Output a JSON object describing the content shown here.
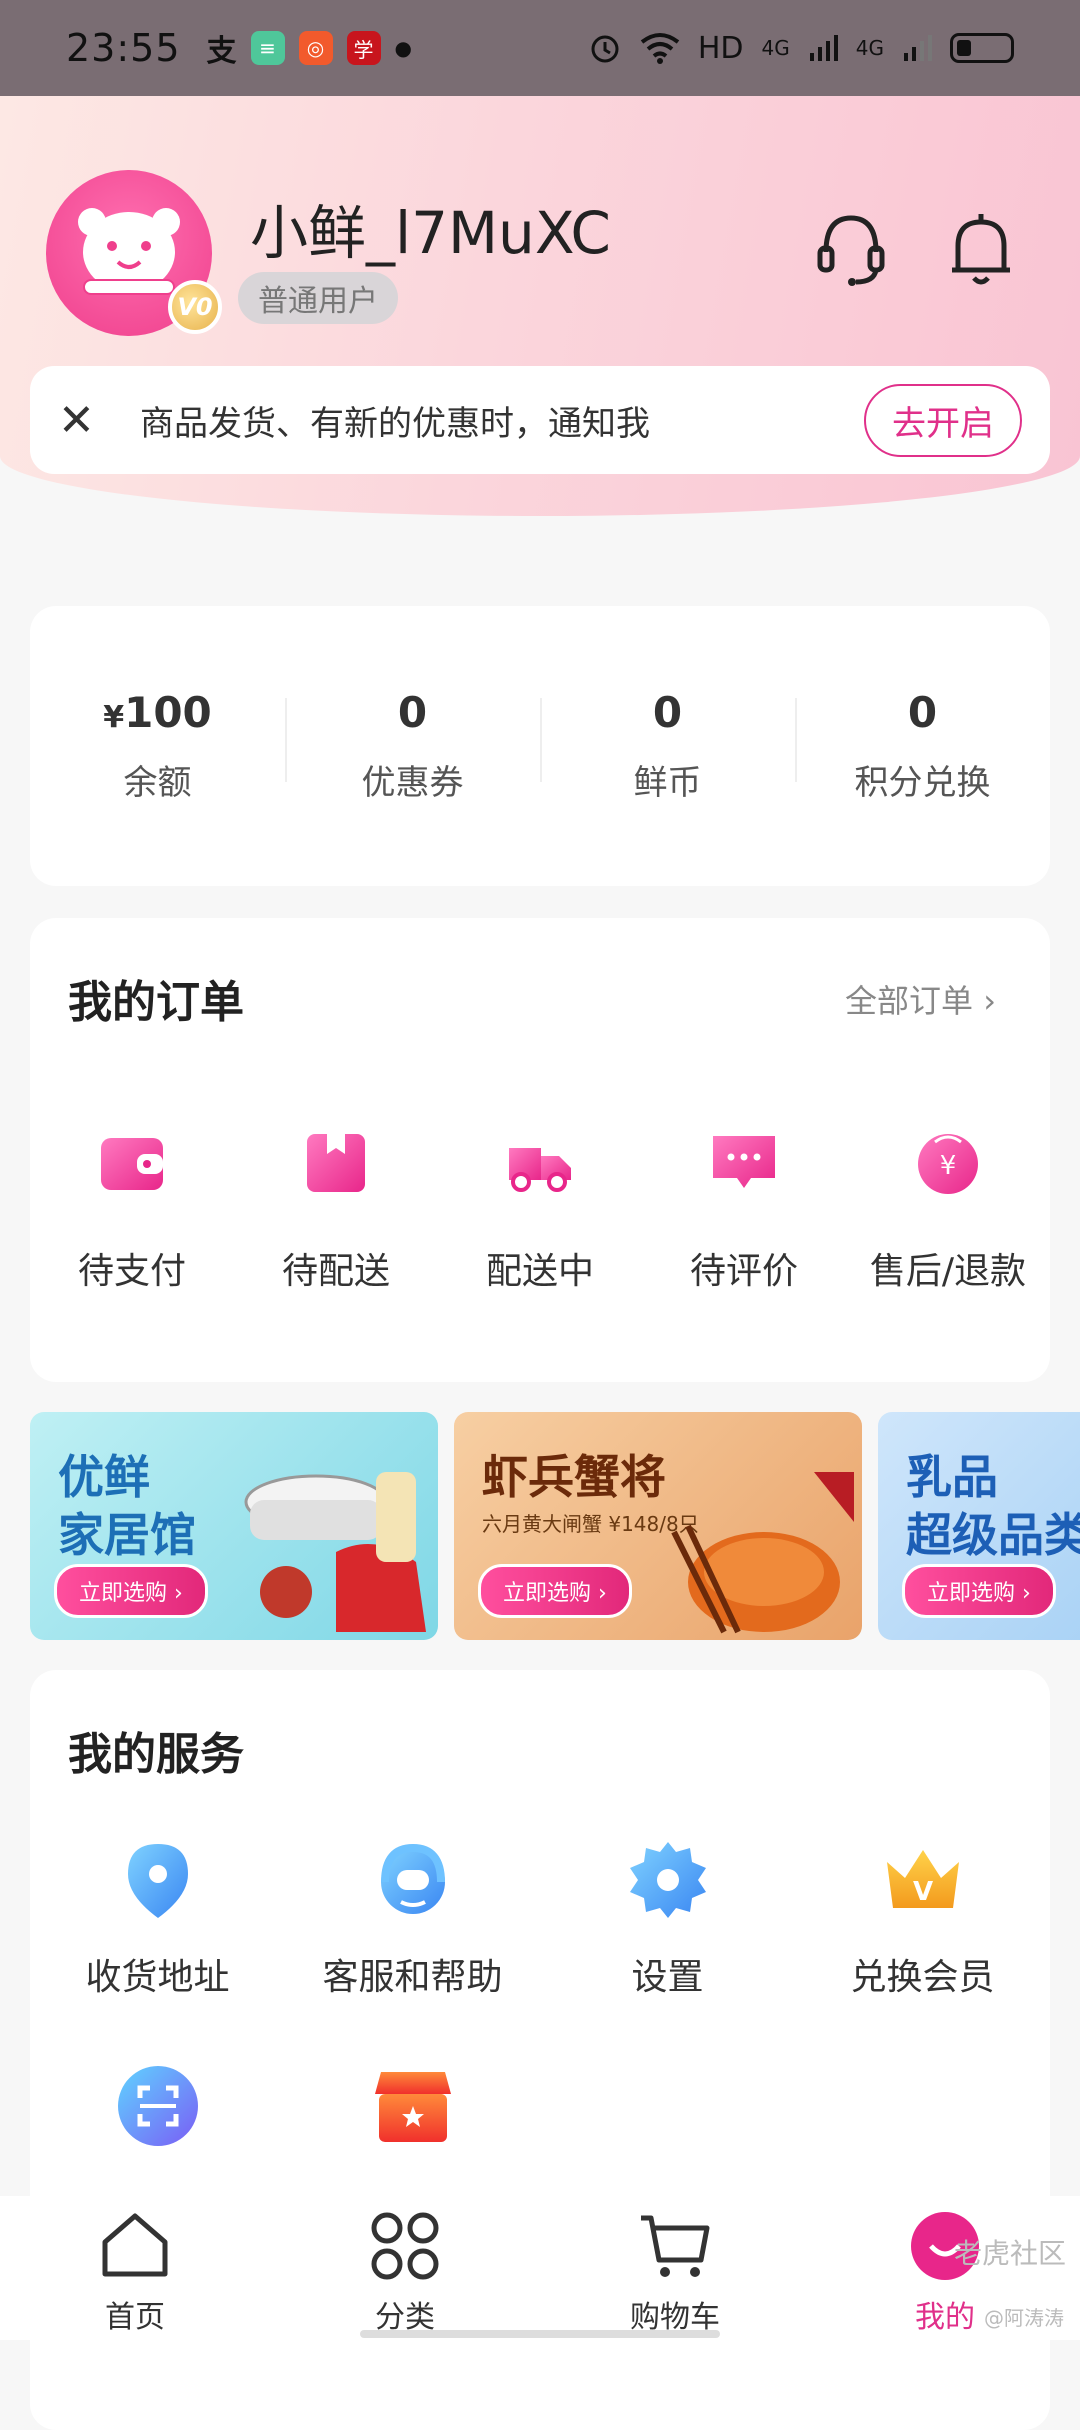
{
  "status_bar": {
    "time": "23:55",
    "network": "HD",
    "signal_1": "4G",
    "signal_2": "4G"
  },
  "profile": {
    "username": "小鲜_l7MuXC",
    "level": "普通用户",
    "vip_badge": "V0"
  },
  "notify": {
    "text": "商品发货、有新的优惠时，通知我",
    "button": "去开启",
    "close_glyph": "✕"
  },
  "assets": [
    {
      "currency": "¥",
      "value": "100",
      "label": "余额"
    },
    {
      "currency": "",
      "value": "0",
      "label": "优惠券"
    },
    {
      "currency": "",
      "value": "0",
      "label": "鲜币"
    },
    {
      "currency": "",
      "value": "0",
      "label": "积分兑换"
    }
  ],
  "orders": {
    "title": "我的订单",
    "all_link": "全部订单 ›",
    "items": [
      {
        "label": "待支付",
        "icon": "wallet-icon"
      },
      {
        "label": "待配送",
        "icon": "box-icon"
      },
      {
        "label": "配送中",
        "icon": "truck-icon"
      },
      {
        "label": "待评价",
        "icon": "comment-icon"
      },
      {
        "label": "售后/退款",
        "icon": "refund-icon"
      }
    ]
  },
  "banners": [
    {
      "title_1": "优鲜",
      "title_2": "家居馆",
      "cta": "立即选购 ›"
    },
    {
      "title_1": "虾兵蟹将",
      "subtitle": "六月黄大闸蟹 ¥148/8只",
      "cta": "立即选购 ›"
    },
    {
      "title_1": "乳品",
      "title_2": "超级品类",
      "cta": "立即选购 ›"
    }
  ],
  "services": {
    "title": "我的服务",
    "items": [
      {
        "label": "收货地址",
        "icon": "location-icon"
      },
      {
        "label": "客服和帮助",
        "icon": "headset-icon"
      },
      {
        "label": "设置",
        "icon": "gear-icon"
      },
      {
        "label": "兑换会员",
        "icon": "crown-icon"
      },
      {
        "label": "",
        "icon": "scan-icon"
      },
      {
        "label": "",
        "icon": "store-icon"
      }
    ]
  },
  "tabs": [
    {
      "label": "首页",
      "icon": "home-icon"
    },
    {
      "label": "分类",
      "icon": "category-icon"
    },
    {
      "label": "购物车",
      "icon": "cart-icon"
    },
    {
      "label": "我的",
      "icon": "profile-icon"
    }
  ],
  "watermark": {
    "main": "老虎社区",
    "sub": "@阿涛涛"
  },
  "colors": {
    "accent": "#e0308a",
    "header_pink": "#f9c4d3",
    "service_blue": "#4a9df8"
  }
}
